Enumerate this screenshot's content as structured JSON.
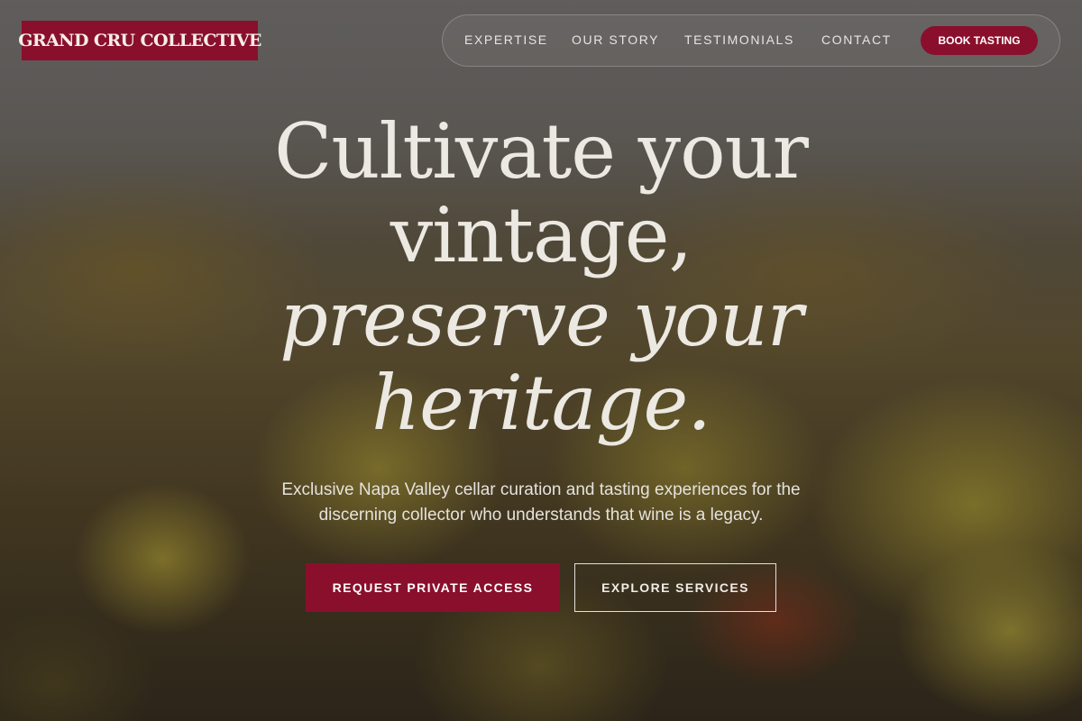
{
  "brand": {
    "logo_text": "GRAND CRU COLLECTIVE",
    "accent_color": "#8a0f2c"
  },
  "nav": {
    "links": [
      {
        "label": "EXPERTISE"
      },
      {
        "label": "OUR STORY"
      },
      {
        "label": "TESTIMONIALS"
      },
      {
        "label": "CONTACT"
      }
    ],
    "cta_label": "BOOK TASTING"
  },
  "hero": {
    "headline_lines": [
      "Cultivate your",
      "vintage,",
      "preserve your",
      "heritage."
    ],
    "subtitle_lines": [
      "Exclusive Napa Valley cellar curation and tasting experiences for the",
      "discerning collector who understands that wine is a legacy."
    ],
    "primary_button": "REQUEST PRIVATE ACCESS",
    "secondary_button": "EXPLORE SERVICES"
  }
}
